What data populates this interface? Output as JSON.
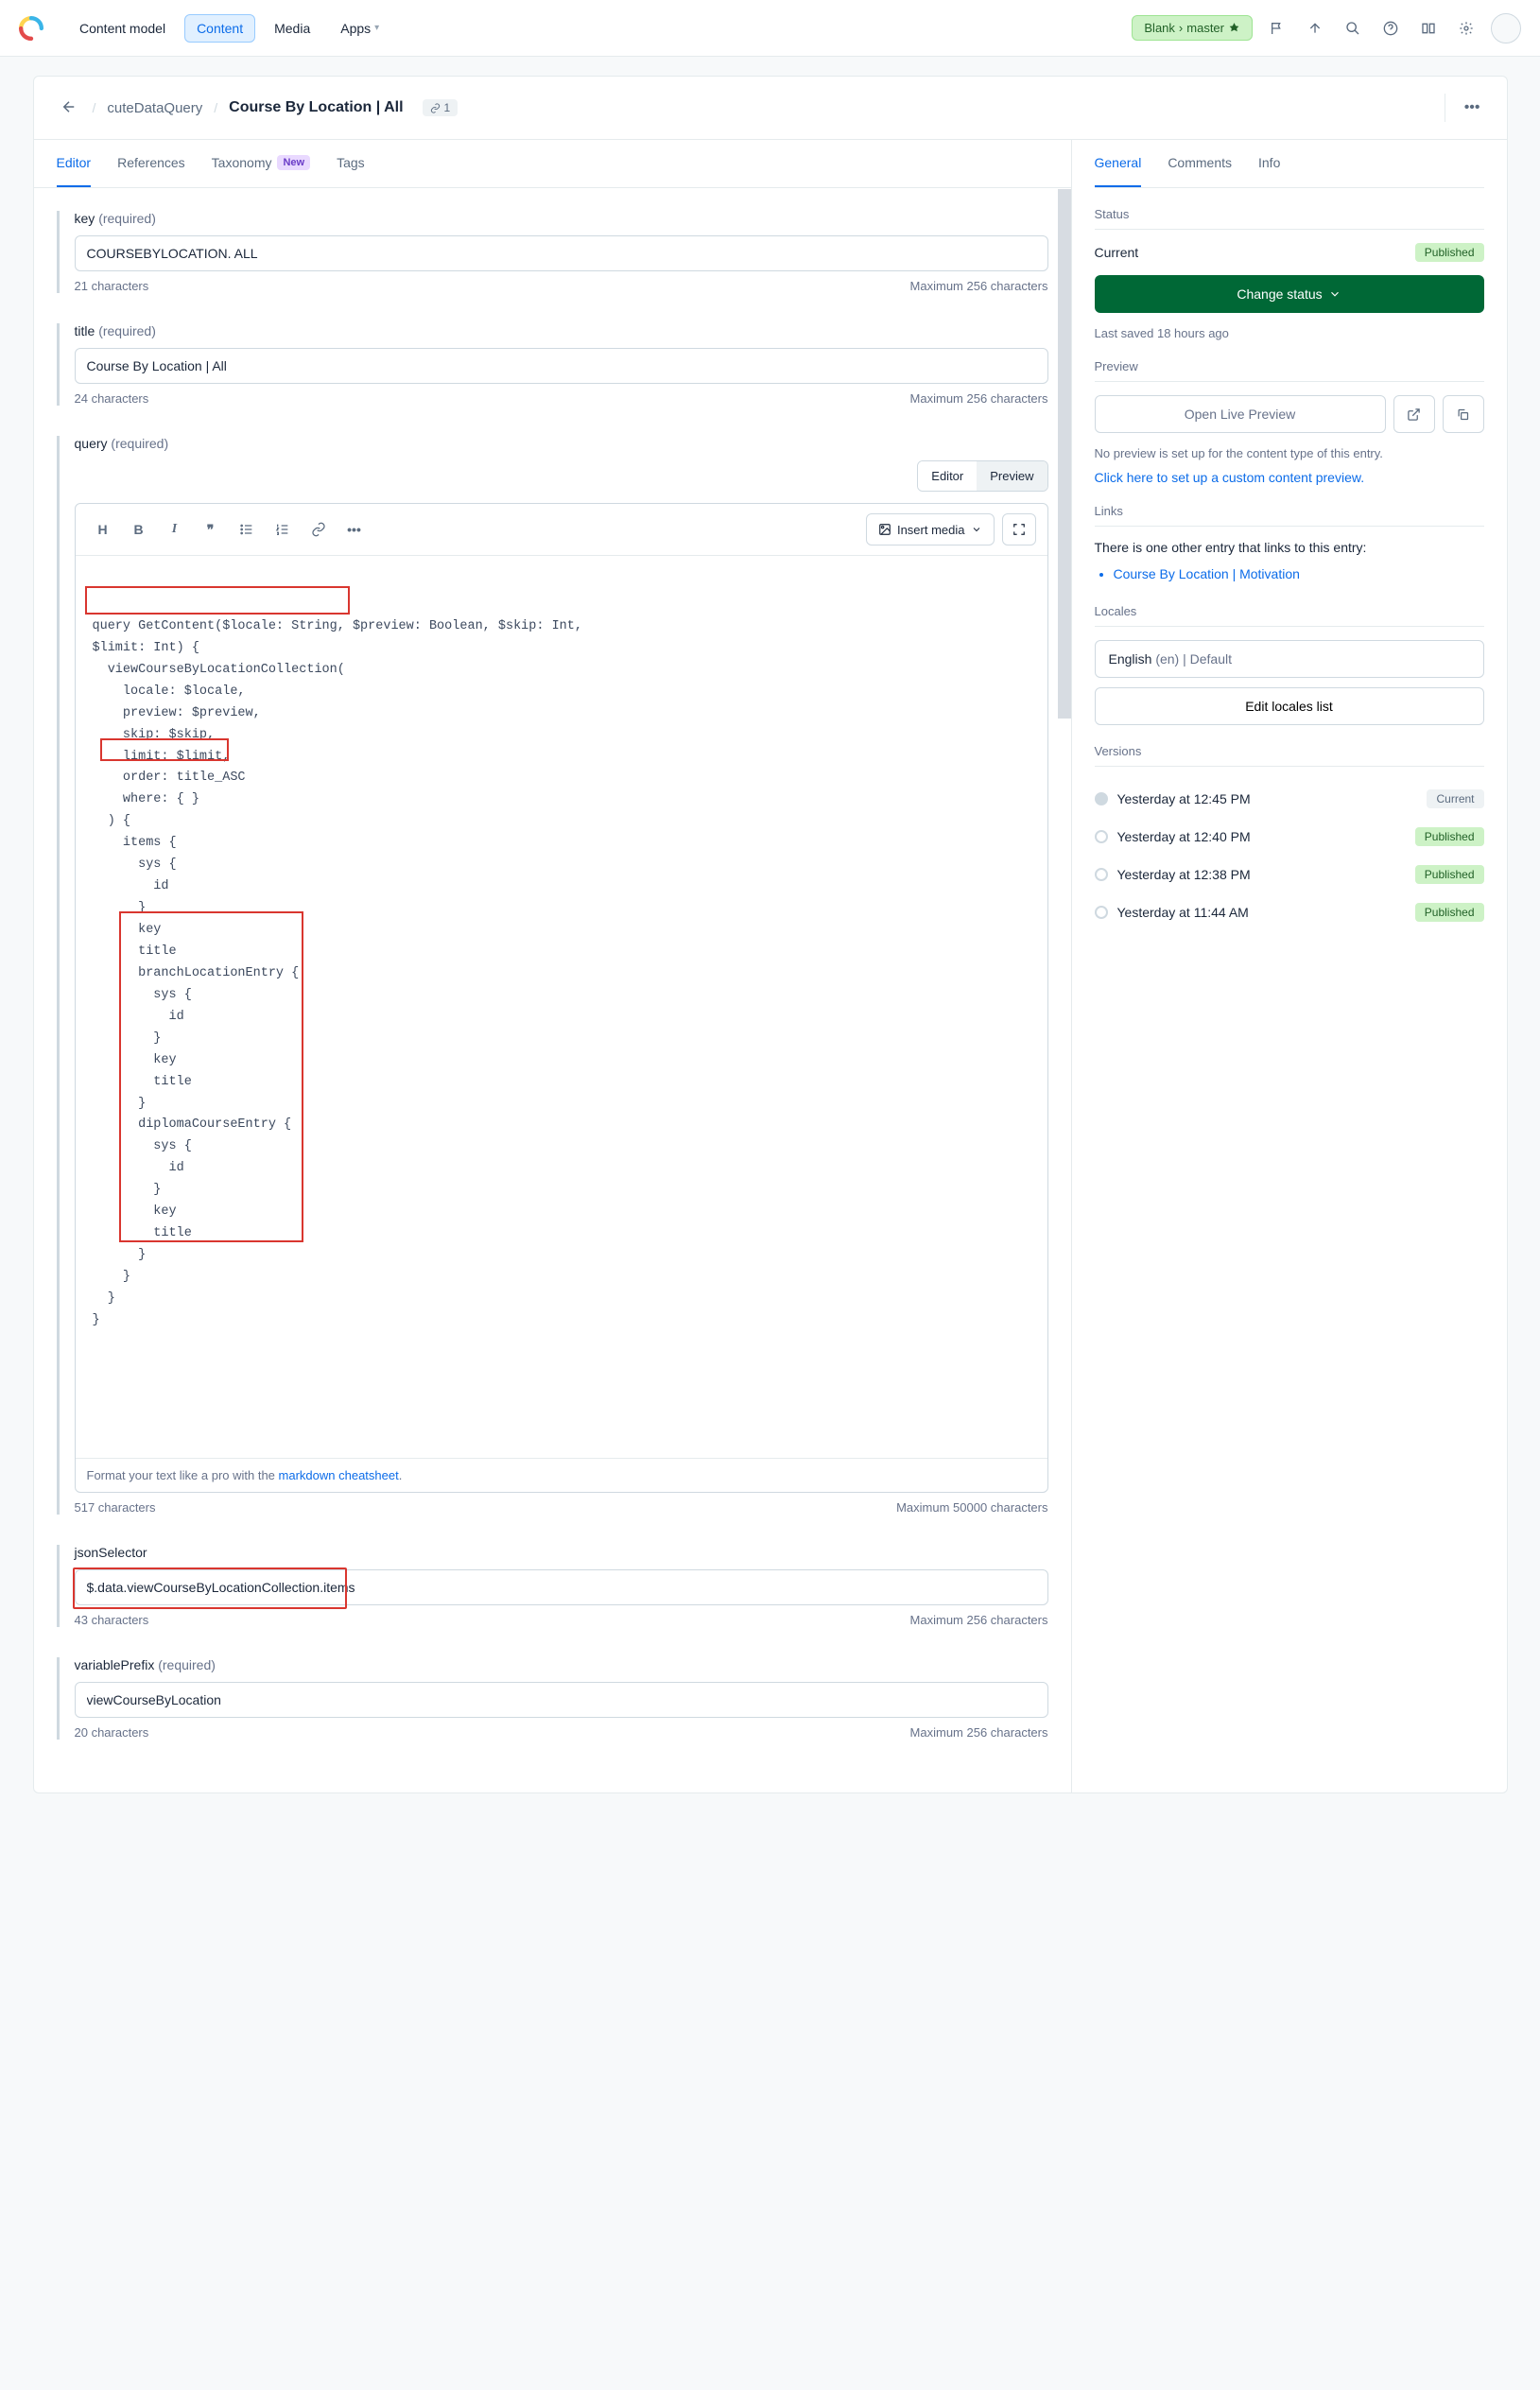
{
  "topnav": {
    "items": [
      "Content model",
      "Content",
      "Media",
      "Apps"
    ],
    "active_index": 1
  },
  "env": {
    "space": "Blank",
    "branch": "master"
  },
  "breadcrumb": {
    "parent": "cuteDataQuery",
    "title": "Course By Location | All",
    "link_count": "1"
  },
  "tabs": {
    "items": [
      "Editor",
      "References",
      "Taxonomy",
      "Tags"
    ],
    "active_index": 0,
    "new_badge_index": 2,
    "new_badge_text": "New"
  },
  "fields": {
    "key": {
      "label": "key",
      "required": "(required)",
      "value": "COURSEBYLOCATION. ALL",
      "count": "21 characters",
      "max": "Maximum 256 characters"
    },
    "title": {
      "label": "title",
      "required": "(required)",
      "value": "Course By Location | All",
      "count": "24 characters",
      "max": "Maximum 256 characters"
    },
    "query": {
      "label": "query",
      "required": "(required)",
      "tabs": {
        "editor": "Editor",
        "preview": "Preview"
      },
      "insert_media": "Insert media",
      "code": "query GetContent($locale: String, $preview: Boolean, $skip: Int,\n$limit: Int) {\n  viewCourseByLocationCollection(\n    locale: $locale,\n    preview: $preview,\n    skip: $skip,\n    limit: $limit,\n    order: title_ASC\n    where: { }\n  ) {\n    items {\n      sys {\n        id\n      }\n      key\n      title\n      branchLocationEntry {\n        sys {\n          id\n        }\n        key\n        title\n      }\n      diplomaCourseEntry {\n        sys {\n          id\n        }\n        key\n        title\n      }\n    }\n  }\n}",
      "footer_prefix": "Format your text like a pro with the ",
      "footer_link": "markdown cheatsheet",
      "count": "517 characters",
      "max": "Maximum 50000 characters"
    },
    "jsonSelector": {
      "label": "jsonSelector",
      "value": "$.data.viewCourseByLocationCollection.items",
      "count": "43 characters",
      "max": "Maximum 256 characters"
    },
    "variablePrefix": {
      "label": "variablePrefix",
      "required": "(required)",
      "value": "viewCourseByLocation",
      "count": "20 characters",
      "max": "Maximum 256 characters"
    }
  },
  "sidebar": {
    "tabs": [
      "General",
      "Comments",
      "Info"
    ],
    "active_index": 0,
    "status": {
      "heading": "Status",
      "current": "Current",
      "pill": "Published",
      "button": "Change status",
      "saved": "Last saved 18 hours ago"
    },
    "preview": {
      "heading": "Preview",
      "button": "Open Live Preview",
      "note": "No preview is set up for the content type of this entry.",
      "link": "Click here to set up a custom content preview."
    },
    "links": {
      "heading": "Links",
      "note": "There is one other entry that links to this entry:",
      "items": [
        "Course By Location | Motivation"
      ]
    },
    "locales": {
      "heading": "Locales",
      "lang": "English",
      "suffix": "(en) | Default",
      "button": "Edit locales list"
    },
    "versions": {
      "heading": "Versions",
      "items": [
        {
          "time": "Yesterday at 12:45 PM",
          "badge": "Current",
          "badge_class": "current",
          "current": true
        },
        {
          "time": "Yesterday at 12:40 PM",
          "badge": "Published",
          "badge_class": "published",
          "current": false
        },
        {
          "time": "Yesterday at 12:38 PM",
          "badge": "Published",
          "badge_class": "published",
          "current": false
        },
        {
          "time": "Yesterday at 11:44 AM",
          "badge": "Published",
          "badge_class": "published",
          "current": false
        }
      ]
    }
  }
}
